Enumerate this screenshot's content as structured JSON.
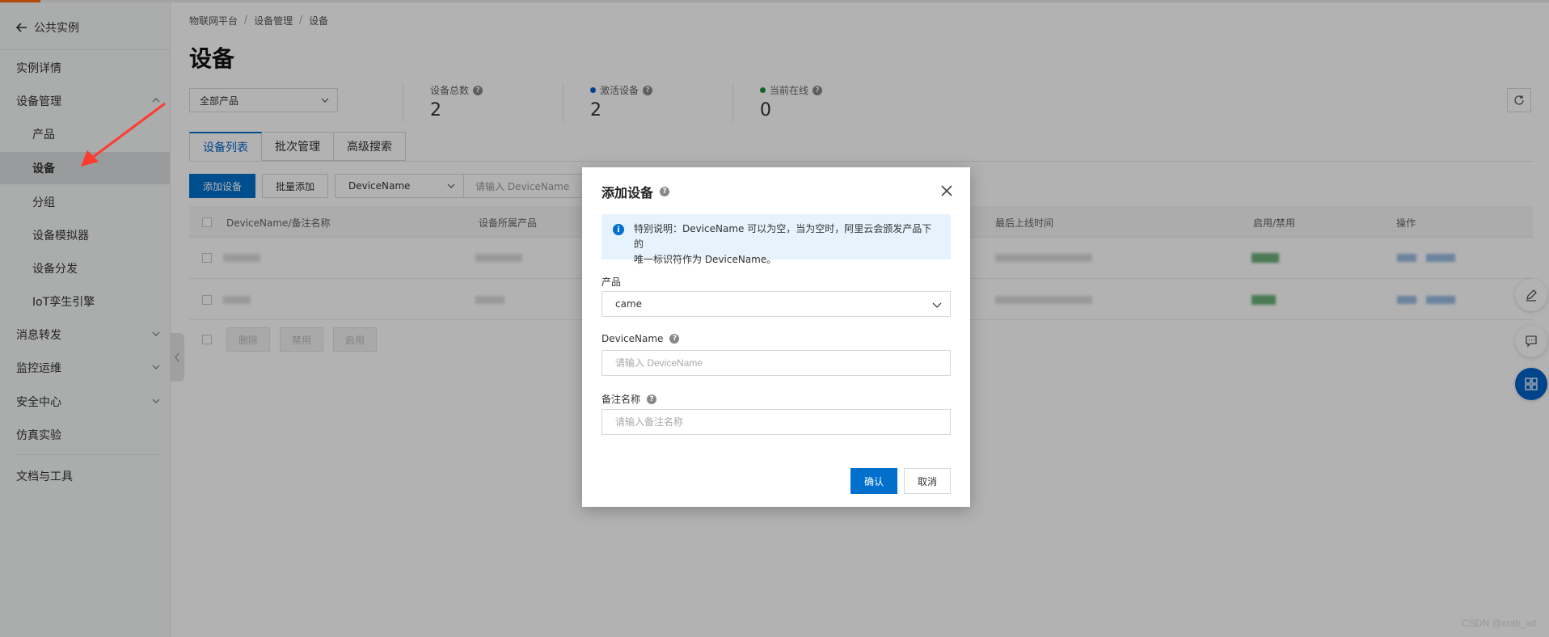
{
  "sidebar": {
    "back_label": "公共实例",
    "items": [
      {
        "label": "实例详情"
      },
      {
        "label": "设备管理"
      },
      {
        "label": "产品"
      },
      {
        "label": "设备"
      },
      {
        "label": "分组"
      },
      {
        "label": "设备模拟器"
      },
      {
        "label": "设备分发"
      },
      {
        "label": "IoT孪生引擎"
      },
      {
        "label": "消息转发"
      },
      {
        "label": "监控运维"
      },
      {
        "label": "安全中心"
      },
      {
        "label": "仿真实验"
      },
      {
        "label": "文档与工具"
      }
    ],
    "active_item": "设备"
  },
  "breadcrumb": [
    "物联网平台",
    "设备管理",
    "设备"
  ],
  "page": {
    "title": "设备",
    "product_filter": "全部产品"
  },
  "stats": {
    "total_label": "设备总数",
    "total_value": "2",
    "active_label": "激活设备",
    "active_value": "2",
    "online_label": "当前在线",
    "online_value": "0"
  },
  "tabs": [
    "设备列表",
    "批次管理",
    "高级搜索"
  ],
  "toolbar": {
    "add_device": "添加设备",
    "batch_add": "批量添加",
    "search_field": "DeviceName",
    "search_placeholder": "请输入 DeviceName"
  },
  "table": {
    "columns": [
      "DeviceName/备注名称",
      "设备所属产品",
      "最后上线时间",
      "启用/禁用",
      "操作"
    ]
  },
  "bulk_actions": [
    "删除",
    "禁用",
    "启用"
  ],
  "dialog": {
    "title": "添加设备",
    "notice_line1": "特别说明：DeviceName 可以为空，当为空时，阿里云会颁发产品下的",
    "notice_line2": "唯一标识符作为 DeviceName。",
    "product_label": "产品",
    "product_value": "came",
    "devicename_label": "DeviceName",
    "devicename_placeholder": "请输入 DeviceName",
    "remark_label": "备注名称",
    "remark_placeholder": "请输入备注名称",
    "confirm": "确认",
    "cancel": "取消"
  },
  "watermark": "CSDN @crab_xd",
  "colors": {
    "primary": "#0070cc",
    "active_dot": "#0064c8",
    "online_dot": "#1e8e3e",
    "arrow": "#ff3b30"
  }
}
